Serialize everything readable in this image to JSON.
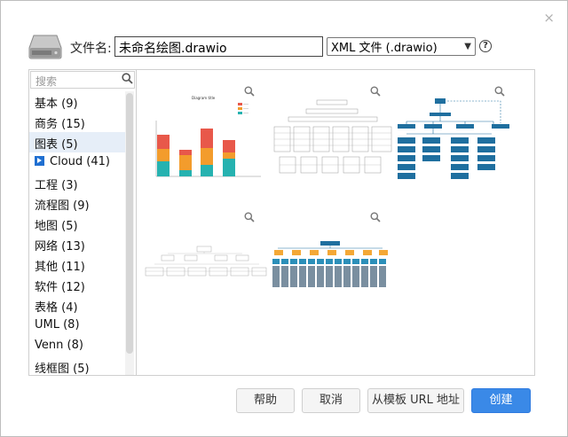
{
  "dialog": {
    "filename_label": "文件名:",
    "filename_value": "未命名绘图.drawio",
    "format_selected": "XML 文件 (.drawio)",
    "help_glyph": "?",
    "close_glyph": "×"
  },
  "sidebar": {
    "search_placeholder": "搜索",
    "categories": [
      {
        "label": "基本 (9)"
      },
      {
        "label": "商务 (15)"
      },
      {
        "label": "图表 (5)",
        "selected": true
      },
      {
        "label": "Cloud (41)",
        "icon": "play-square-icon"
      },
      {
        "label": "工程 (3)"
      },
      {
        "label": "流程图 (9)"
      },
      {
        "label": "地图 (5)"
      },
      {
        "label": "网络 (13)"
      },
      {
        "label": "其他 (11)"
      },
      {
        "label": "软件 (12)"
      },
      {
        "label": "表格 (4)"
      },
      {
        "label": "UML (8)"
      },
      {
        "label": "Venn (8)"
      },
      {
        "label": "线框图 (5)"
      }
    ]
  },
  "gallery": {
    "templates": [
      {
        "name": "bar-chart-template",
        "chart_title": "Diagram title"
      },
      {
        "name": "tree-table-template"
      },
      {
        "name": "org-chart-template"
      },
      {
        "name": "hierarchy-template"
      },
      {
        "name": "orange-blue-org-template"
      }
    ]
  },
  "buttons": {
    "help": "帮助",
    "cancel": "取消",
    "from_template_url": "从模板 URL 地址",
    "create": "创建"
  },
  "colors": {
    "primary": "#3a89e7",
    "selected_category": "#e6eef8",
    "bar_red": "#e8584a",
    "bar_orange": "#f39c2c",
    "bar_teal": "#26b2b0",
    "org_blue": "#1f6f9f",
    "org_orange": "#f4a836"
  }
}
